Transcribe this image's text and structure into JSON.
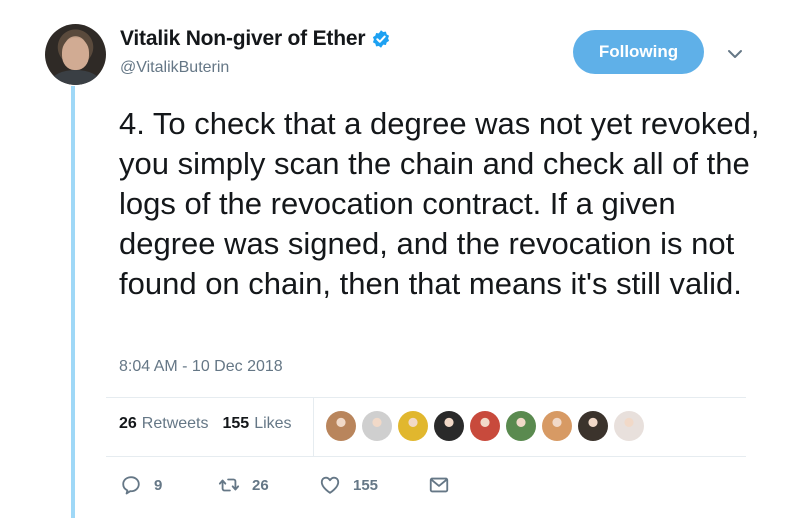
{
  "user": {
    "display_name": "Vitalik Non-giver of Ether",
    "handle": "@VitalikButerin",
    "follow_label": "Following"
  },
  "tweet": {
    "text": "4. To check that a degree was not yet revoked, you simply scan the chain and check all of the logs of the revocation contract. If a given degree was signed, and the revocation is not found on chain, then that means it's still valid.",
    "timestamp": "8:04 AM - 10 Dec 2018"
  },
  "stats": {
    "retweets_count": "26",
    "retweets_label": "Retweets",
    "likes_count": "155",
    "likes_label": "Likes"
  },
  "likers": [
    {
      "icon": "liker-avatar",
      "color": "#b9855c"
    },
    {
      "icon": "liker-avatar",
      "color": "#cfcfcf"
    },
    {
      "icon": "liker-avatar",
      "color": "#e1b72e"
    },
    {
      "icon": "liker-avatar",
      "color": "#2a2a2a"
    },
    {
      "icon": "liker-avatar",
      "color": "#c84a3c"
    },
    {
      "icon": "liker-avatar",
      "color": "#5a8a4f"
    },
    {
      "icon": "liker-avatar",
      "color": "#d79a64"
    },
    {
      "icon": "liker-avatar",
      "color": "#3b332c"
    },
    {
      "icon": "liker-avatar",
      "color": "#e8e0dc"
    }
  ],
  "actions": {
    "reply_count": "9",
    "retweet_count": "26",
    "like_count": "155"
  },
  "colors": {
    "accent": "#5fb0e8",
    "thread_line": "#9fd8f7",
    "muted": "#657786"
  }
}
